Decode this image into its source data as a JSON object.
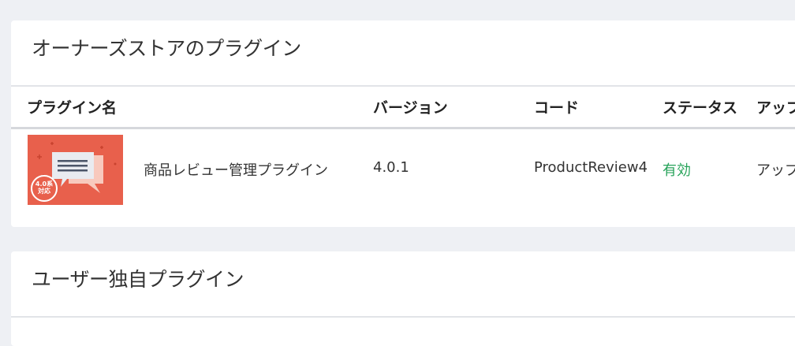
{
  "store_section": {
    "title": "オーナーズストアのプラグイン",
    "columns": {
      "name": "プラグイン名",
      "version": "バージョン",
      "code": "コード",
      "status": "ステータス",
      "update": "アップ"
    },
    "rows": [
      {
        "thumbnail_badge_line1": "4.0系",
        "thumbnail_badge_line2": "対応",
        "thumbnail_icon": "chat-bubbles-icon",
        "name": "商品レビュー管理プラグイン",
        "version": "4.0.1",
        "code": "ProductReview4",
        "status": "有効",
        "update": "アップ"
      }
    ]
  },
  "user_section": {
    "title": "ユーザー独自プラグイン"
  },
  "colors": {
    "background": "#eef0f4",
    "card": "#ffffff",
    "status_active": "#27a35a",
    "thumbnail": "#e8604c"
  }
}
